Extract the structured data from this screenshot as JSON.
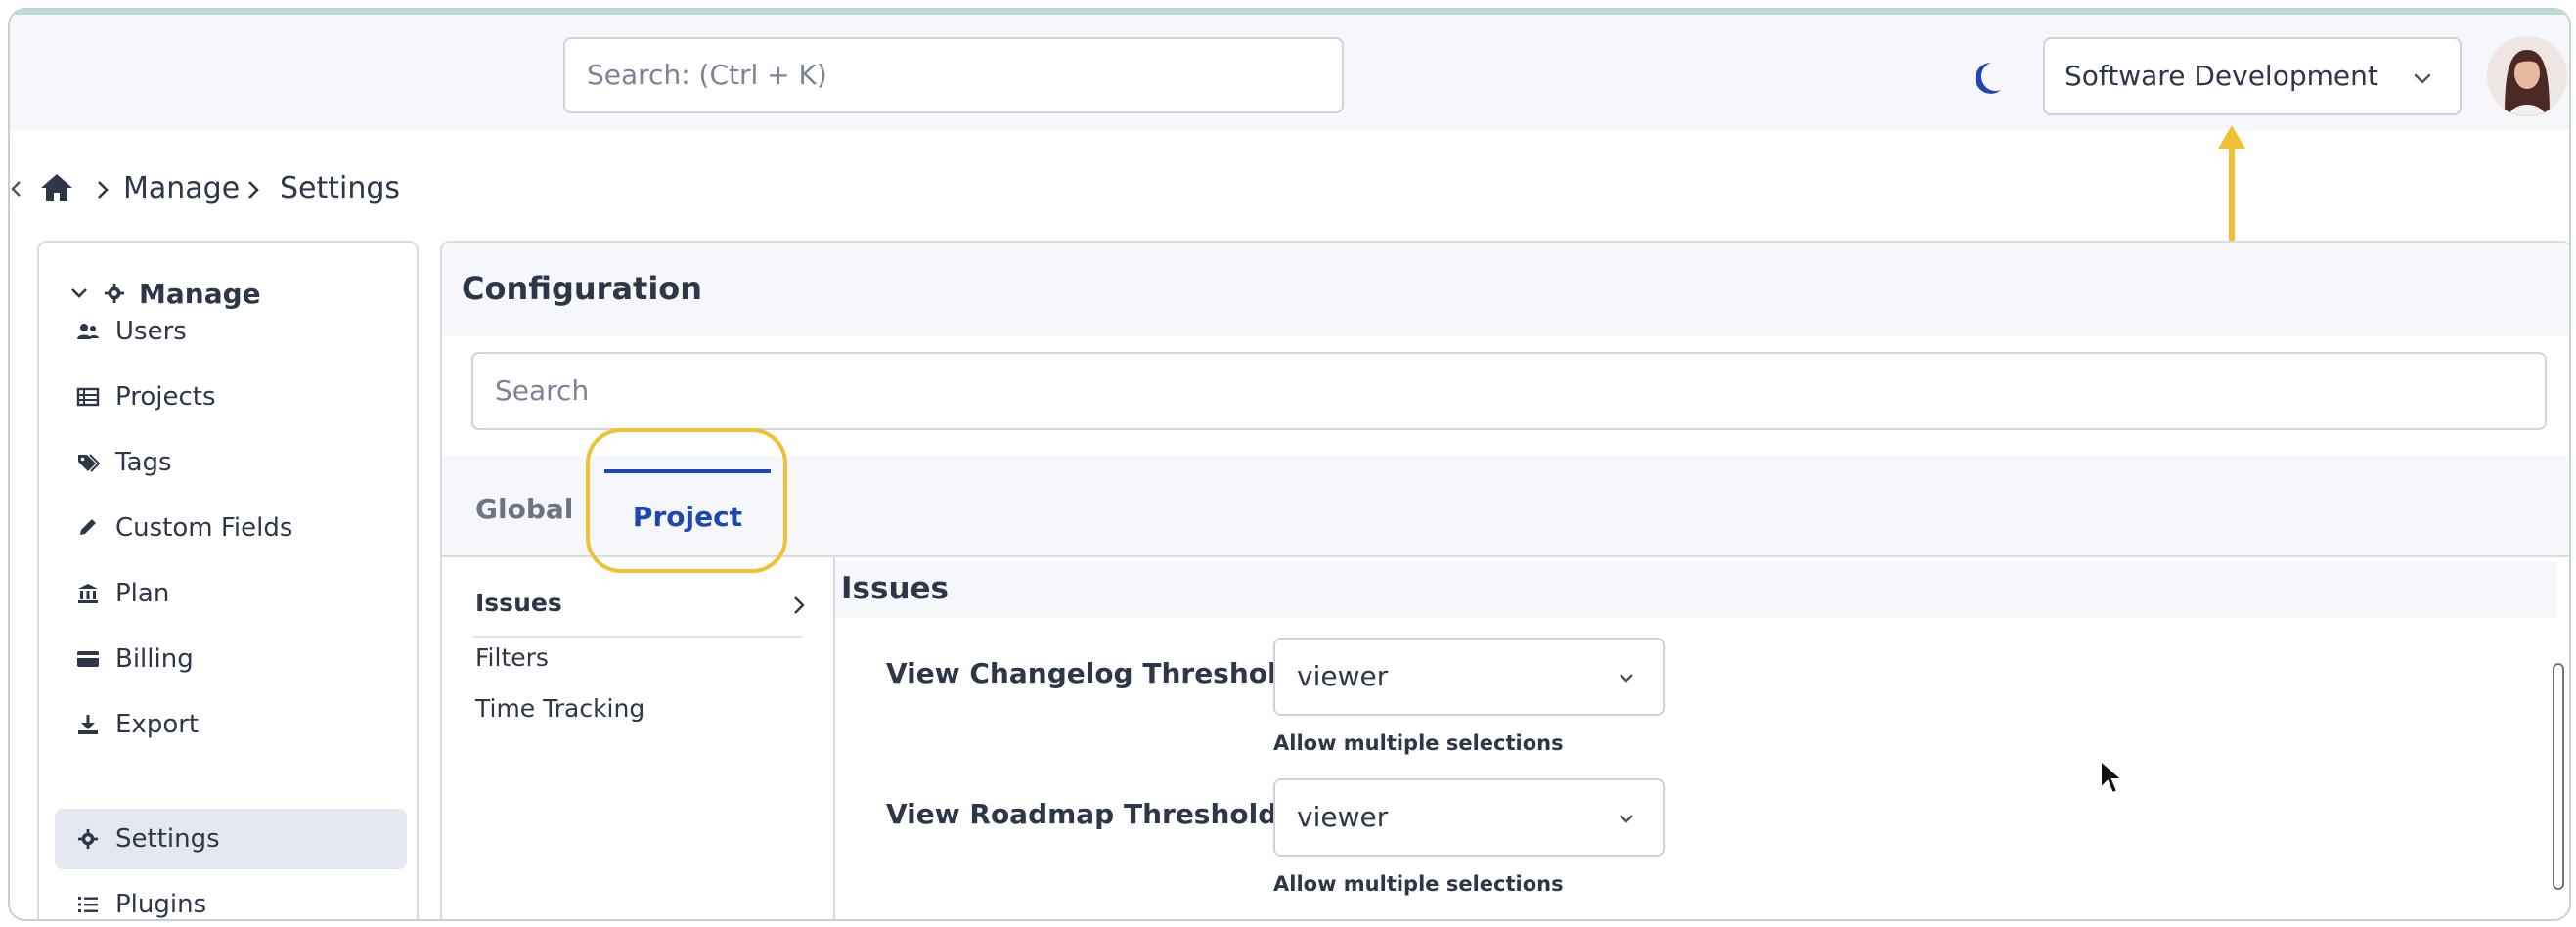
{
  "topbar": {
    "search_placeholder": "Search: (Ctrl + K)",
    "project_selector": "Software Development",
    "icons": [
      "moon-icon",
      "chevron-down-icon",
      "avatar"
    ]
  },
  "breadcrumb": {
    "items": [
      "Manage",
      "Settings"
    ],
    "icons": [
      "home-icon",
      "chevron-right-icon"
    ]
  },
  "sidebar": {
    "section": "Manage",
    "items": [
      {
        "label": "Users",
        "icon": "users-icon"
      },
      {
        "label": "Projects",
        "icon": "table-icon"
      },
      {
        "label": "Tags",
        "icon": "tags-icon"
      },
      {
        "label": "Custom Fields",
        "icon": "pencil-icon"
      },
      {
        "label": "Plan",
        "icon": "bank-icon"
      },
      {
        "label": "Billing",
        "icon": "credit-card-icon"
      },
      {
        "label": "Export",
        "icon": "download-icon"
      },
      {
        "label": "Settings",
        "icon": "gear-icon",
        "active": true
      },
      {
        "label": "Plugins",
        "icon": "list-icon"
      }
    ]
  },
  "main": {
    "title": "Configuration",
    "search_placeholder": "Search",
    "tabs": [
      {
        "label": "Global",
        "active": false
      },
      {
        "label": "Project",
        "active": true
      }
    ],
    "subnav": [
      "Issues",
      "Filters",
      "Time Tracking"
    ],
    "section_title": "Issues",
    "fields": [
      {
        "label": "View Changelog Threshold",
        "value": "viewer",
        "help": "Allow multiple selections"
      },
      {
        "label": "View Roadmap Threshold",
        "value": "viewer",
        "help": "Allow multiple selections"
      }
    ]
  },
  "colors": {
    "accent": "#1f47b3",
    "highlight": "#f2c034",
    "panel_bg": "#f5f7fa",
    "border": "#ccd3dc"
  }
}
